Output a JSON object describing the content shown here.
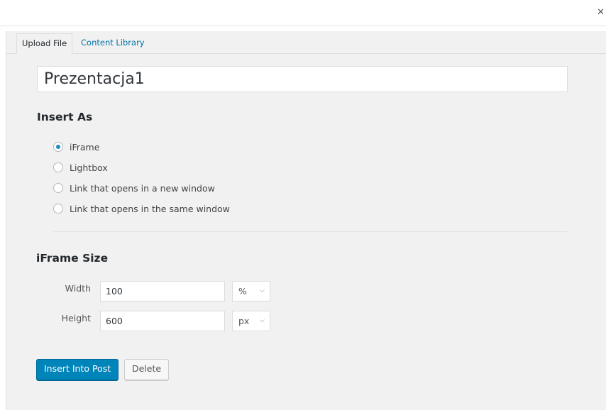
{
  "window": {
    "close_icon": "close-icon"
  },
  "tabs": [
    {
      "label": "Upload File",
      "active": true
    },
    {
      "label": "Content Library",
      "active": false
    }
  ],
  "title_field": {
    "value": "Prezentacja1"
  },
  "insert_as": {
    "heading": "Insert As",
    "options": [
      {
        "label": "iFrame",
        "checked": true
      },
      {
        "label": "Lightbox",
        "checked": false
      },
      {
        "label": "Link that opens in a new window",
        "checked": false
      },
      {
        "label": "Link that opens in the same window",
        "checked": false
      }
    ]
  },
  "iframe_size": {
    "heading": "iFrame Size",
    "width": {
      "label": "Width",
      "value": "100",
      "unit": "%"
    },
    "height": {
      "label": "Height",
      "value": "600",
      "unit": "px"
    }
  },
  "actions": {
    "insert_label": "Insert Into Post",
    "delete_label": "Delete"
  },
  "colors": {
    "primary": "#0085ba",
    "link": "#0073aa",
    "panel_bg": "#f1f1f1"
  }
}
